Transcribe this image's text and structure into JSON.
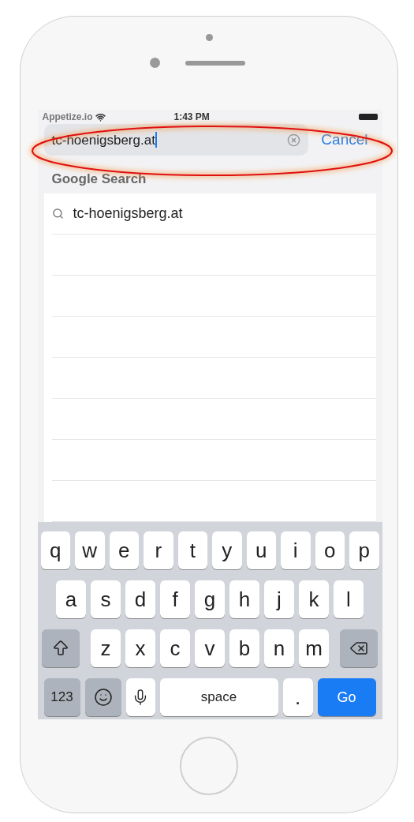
{
  "status_bar": {
    "carrier": "Appetize.io",
    "time": "1:43 PM"
  },
  "search": {
    "value": "tc-hoenigsberg.at",
    "cancel": "Cancel"
  },
  "section_title": "Google Search",
  "suggestions": [
    {
      "text": "tc-hoenigsberg.at"
    }
  ],
  "keyboard": {
    "rows": [
      {
        "keys": [
          {
            "kind": "letter",
            "label": "q"
          },
          {
            "kind": "letter",
            "label": "w"
          },
          {
            "kind": "letter",
            "label": "e"
          },
          {
            "kind": "letter",
            "label": "r"
          },
          {
            "kind": "letter",
            "label": "t"
          },
          {
            "kind": "letter",
            "label": "y"
          },
          {
            "kind": "letter",
            "label": "u"
          },
          {
            "kind": "letter",
            "label": "i"
          },
          {
            "kind": "letter",
            "label": "o"
          },
          {
            "kind": "letter",
            "label": "p"
          }
        ]
      },
      {
        "keys": [
          {
            "kind": "letter",
            "label": "a"
          },
          {
            "kind": "letter",
            "label": "s"
          },
          {
            "kind": "letter",
            "label": "d"
          },
          {
            "kind": "letter",
            "label": "f"
          },
          {
            "kind": "letter",
            "label": "g"
          },
          {
            "kind": "letter",
            "label": "h"
          },
          {
            "kind": "letter",
            "label": "j"
          },
          {
            "kind": "letter",
            "label": "k"
          },
          {
            "kind": "letter",
            "label": "l"
          }
        ]
      },
      {
        "keys": [
          {
            "kind": "shift"
          },
          {
            "kind": "letter",
            "label": "z"
          },
          {
            "kind": "letter",
            "label": "x"
          },
          {
            "kind": "letter",
            "label": "c"
          },
          {
            "kind": "letter",
            "label": "v"
          },
          {
            "kind": "letter",
            "label": "b"
          },
          {
            "kind": "letter",
            "label": "n"
          },
          {
            "kind": "letter",
            "label": "m"
          },
          {
            "kind": "delete"
          }
        ]
      },
      {
        "keys": [
          {
            "kind": "numbers",
            "label": "123"
          },
          {
            "kind": "emoji"
          },
          {
            "kind": "mic"
          },
          {
            "kind": "space",
            "label": "space"
          },
          {
            "kind": "letter",
            "label": "."
          },
          {
            "kind": "go",
            "label": "Go"
          }
        ]
      }
    ]
  }
}
